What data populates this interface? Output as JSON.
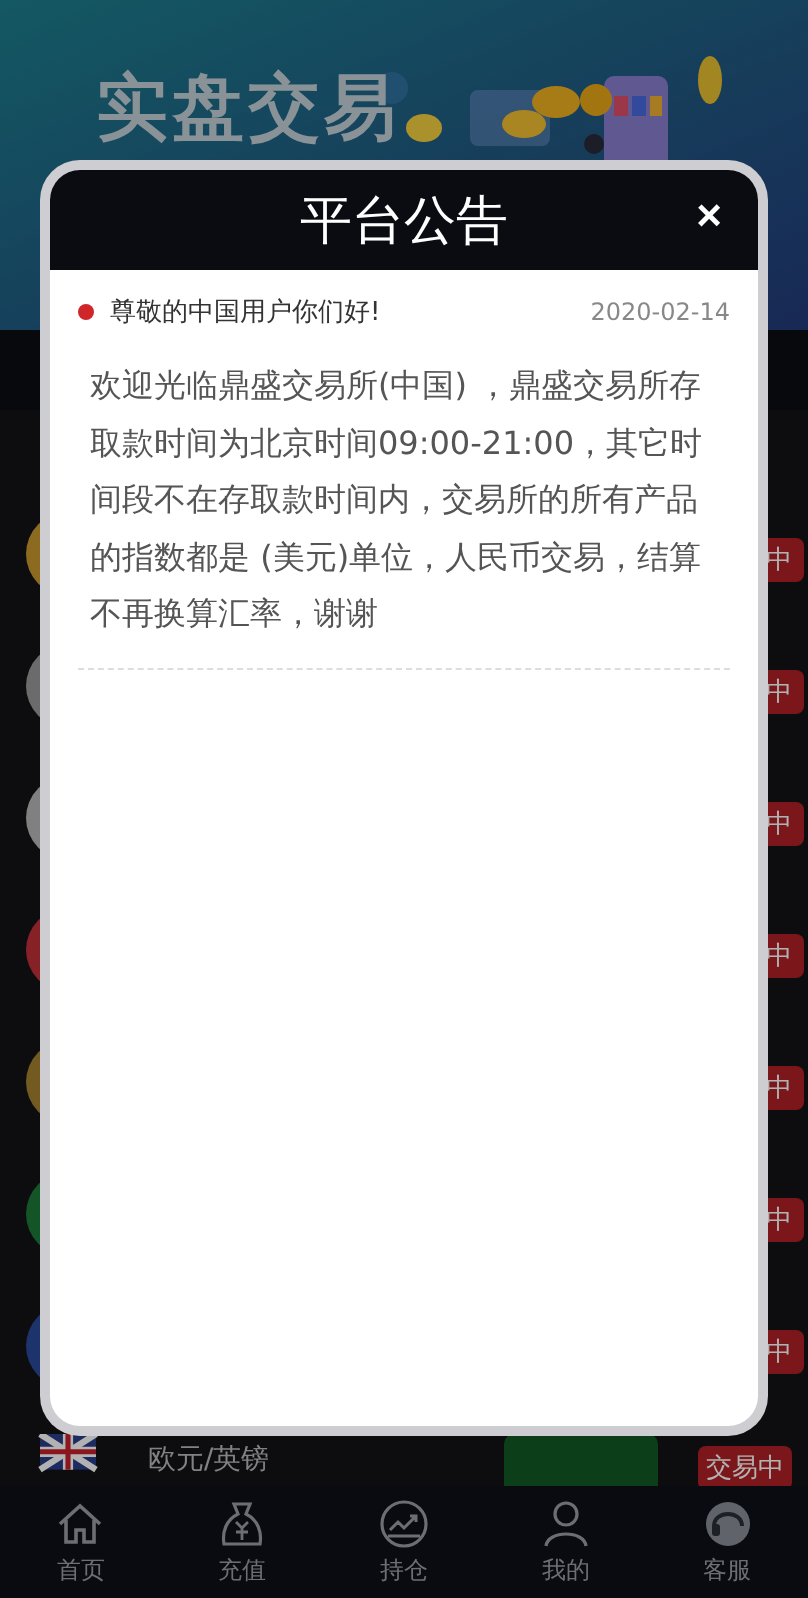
{
  "banner": {
    "title": "实盘交易"
  },
  "market_rows": [
    {
      "kind": "covered",
      "badge": "中"
    },
    {
      "kind": "covered",
      "badge": "中"
    },
    {
      "kind": "covered",
      "badge": "中"
    },
    {
      "kind": "covered",
      "badge": "中"
    },
    {
      "kind": "covered",
      "badge": "中"
    },
    {
      "kind": "covered",
      "badge": "中"
    },
    {
      "kind": "covered",
      "badge": "中"
    },
    {
      "kind": "full",
      "name": "欧元/英镑",
      "badge": "交易中"
    }
  ],
  "dialog": {
    "title": "平台公告",
    "close": "×",
    "notice": {
      "title": "尊敬的中国用户你们好!",
      "date": "2020-02-14",
      "body": "欢迎光临鼎盛交易所(中国) ，鼎盛交易所存取款时间为北京时间09:00-21:00，其它时间段不在存取款时间内，交易所的所有产品的指数都是 (美元)单位，人民币交易，结算不再换算汇率，谢谢"
    }
  },
  "nav": [
    {
      "label": "首页"
    },
    {
      "label": "充值"
    },
    {
      "label": "持仓"
    },
    {
      "label": "我的"
    },
    {
      "label": "客服"
    }
  ]
}
